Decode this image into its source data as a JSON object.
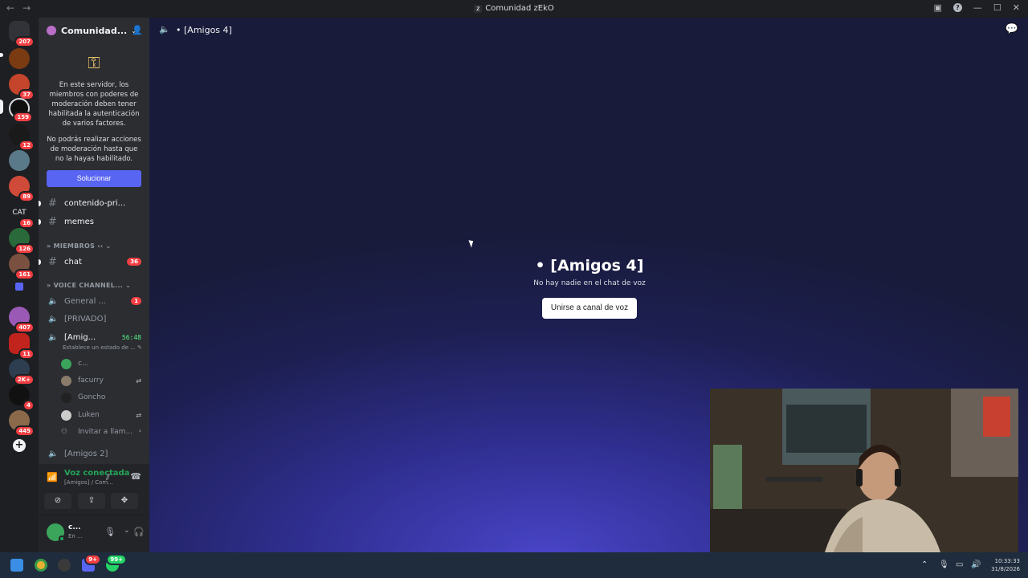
{
  "window": {
    "title": "Comunidad zEkO",
    "app_letter": "z"
  },
  "guilds": {
    "badges": [
      "207",
      "37",
      "159",
      "12",
      "89",
      "16",
      "126",
      "161",
      "407",
      "11",
      "2K+",
      "4",
      "445"
    ],
    "cat_label": "CAT"
  },
  "server": {
    "name": "Comunidad...",
    "mfa_notice_1": "En este servidor, los miembros con poderes de moderación deben tener habilitada la autenticación de varios factores.",
    "mfa_notice_2": "No podrás realizar acciones de moderación hasta que no la hayas habilitado.",
    "fix_button": "Solucionar"
  },
  "channels": {
    "contenido": "contenido-pri...",
    "memes": "memes",
    "members_category": "MIEMBROS",
    "chat": "chat",
    "chat_badge": "36",
    "voice_category": "VOICE CHANNEL...",
    "general": "General ...",
    "general_badge": "1",
    "privado": "[PRIVADO]",
    "amigos4": "[Amig...",
    "amigos4_timer": "56:48",
    "status_prompt": "Establece un estado de ...",
    "amigos2": "[Amigos 2]",
    "invite": "Invitar a llam..."
  },
  "voice_users": [
    "c...",
    "facurry",
    "Goncho",
    "Luken"
  ],
  "voice_panel": {
    "title": "Voz conectada",
    "subtitle": "[Amigos] / Com..."
  },
  "user_panel": {
    "name": "c...",
    "status": "En ..."
  },
  "main": {
    "header_title": "[Amigos 4]",
    "center_title": "[Amigos 4]",
    "empty_text": "No hay nadie en el chat de voz",
    "join_button": "Unirse a canal de voz"
  },
  "taskbar": {
    "discord_badge": "9+",
    "whatsapp_badge": "99+",
    "time": "10:33:33",
    "date": "31/8/2026"
  },
  "colors": {
    "accent": "#5865f2",
    "voice_green": "#23a559",
    "badge_red": "#f23f43",
    "sidebar": "#2b2d31",
    "rail": "#1e1f22"
  }
}
